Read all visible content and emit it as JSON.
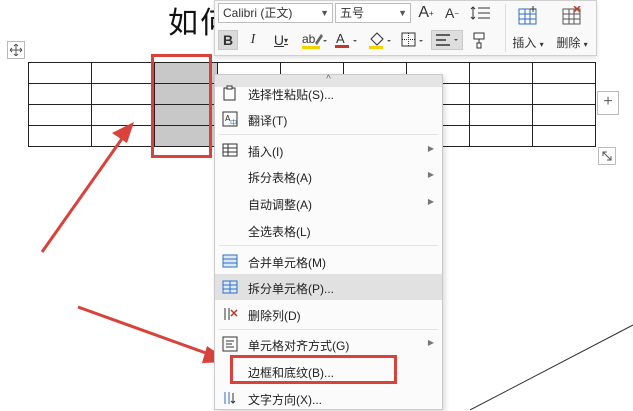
{
  "document": {
    "title_partial": "如何"
  },
  "table": {
    "rows": 4,
    "cols": 9,
    "selected_col": 2
  },
  "toolbar": {
    "font_family": "Calibri (正文)",
    "font_size": "五号",
    "grow_font": "A",
    "shrink_font": "A",
    "bold": "B",
    "italic": "I",
    "underline": "U",
    "font_color": "A",
    "insert_label": "插入",
    "delete_label": "删除"
  },
  "context_menu": {
    "items": [
      {
        "label": "选择性粘贴(S)..."
      },
      {
        "label": "翻译(T)"
      },
      {
        "label": "插入(I)"
      },
      {
        "label": "拆分表格(A)"
      },
      {
        "label": "自动调整(A)"
      },
      {
        "label": "全选表格(L)"
      },
      {
        "label": "合并单元格(M)"
      },
      {
        "label": "拆分单元格(P)..."
      },
      {
        "label": "删除列(D)"
      },
      {
        "label": "单元格对齐方式(G)"
      },
      {
        "label": "边框和底纹(B)..."
      },
      {
        "label": "文字方向(X)..."
      }
    ]
  },
  "colors": {
    "annotation_red": "#d9423b",
    "selection_gray": "#c8c8c8",
    "menu_hover": "#e1e1e1",
    "accent_blue": "#2f6fbf"
  }
}
